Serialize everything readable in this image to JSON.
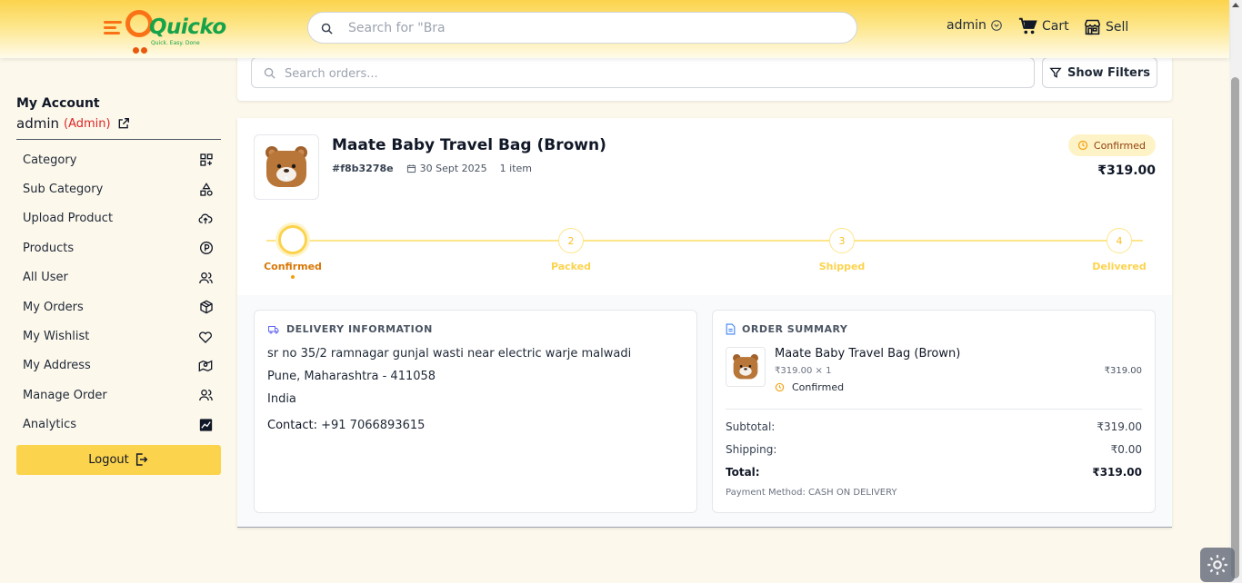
{
  "header": {
    "logo_text": "Quicko",
    "logo_tagline": "Quick. Easy. Done",
    "search_placeholder": "Search for \"Bra",
    "user_label": "admin",
    "cart_label": "Cart",
    "sell_label": "Sell"
  },
  "sidebar": {
    "title": "My Account",
    "username": "admin",
    "role": "(Admin)",
    "items": [
      {
        "label": "Category",
        "icon": "category-add-icon"
      },
      {
        "label": "Sub Category",
        "icon": "shapes-icon"
      },
      {
        "label": "Upload Product",
        "icon": "cloud-upload-icon"
      },
      {
        "label": "Products",
        "icon": "product-p-icon"
      },
      {
        "label": "All User",
        "icon": "users-icon"
      },
      {
        "label": "My Orders",
        "icon": "package-icon"
      },
      {
        "label": "My Wishlist",
        "icon": "heart-icon"
      },
      {
        "label": "My Address",
        "icon": "map-icon"
      },
      {
        "label": "Manage Order",
        "icon": "users-icon"
      },
      {
        "label": "Analytics",
        "icon": "chart-icon"
      }
    ],
    "logout_label": "Logout"
  },
  "orders_toolbar": {
    "search_placeholder": "Search orders...",
    "filters_label": "Show Filters"
  },
  "order": {
    "product_name": "Maate Baby Travel Bag (Brown)",
    "order_id": "#f8b3278e",
    "date": "30 Sept 2025",
    "item_count": "1 item",
    "status": "Confirmed",
    "total": "₹319.00",
    "steps": [
      {
        "number": "",
        "label": "Confirmed",
        "active": true
      },
      {
        "number": "2",
        "label": "Packed",
        "active": false
      },
      {
        "number": "3",
        "label": "Shipped",
        "active": false
      },
      {
        "number": "4",
        "label": "Delivered",
        "active": false
      }
    ],
    "delivery": {
      "title": "DELIVERY INFORMATION",
      "line1": "sr no 35/2 ramnagar gunjal wasti near electric warje malwadi",
      "line2": "Pune, Maharashtra - 411058",
      "line3": "India",
      "contact_label": "Contact:",
      "contact_value": "+91 7066893615"
    },
    "summary": {
      "title": "ORDER SUMMARY",
      "item_name": "Maate Baby Travel Bag (Brown)",
      "item_qty": "₹319.00 × 1",
      "item_status": "Confirmed",
      "item_price": "₹319.00",
      "subtotal_label": "Subtotal:",
      "subtotal_value": "₹319.00",
      "shipping_label": "Shipping:",
      "shipping_value": "₹0.00",
      "total_label": "Total:",
      "total_value": "₹319.00",
      "payment_method": "Payment Method: CASH ON DELIVERY"
    }
  },
  "colors": {
    "accent": "#fcd34d",
    "brand_green": "#16a34a",
    "brand_orange": "#f97316",
    "status_text": "#d97706",
    "role_red": "#dc2626"
  }
}
